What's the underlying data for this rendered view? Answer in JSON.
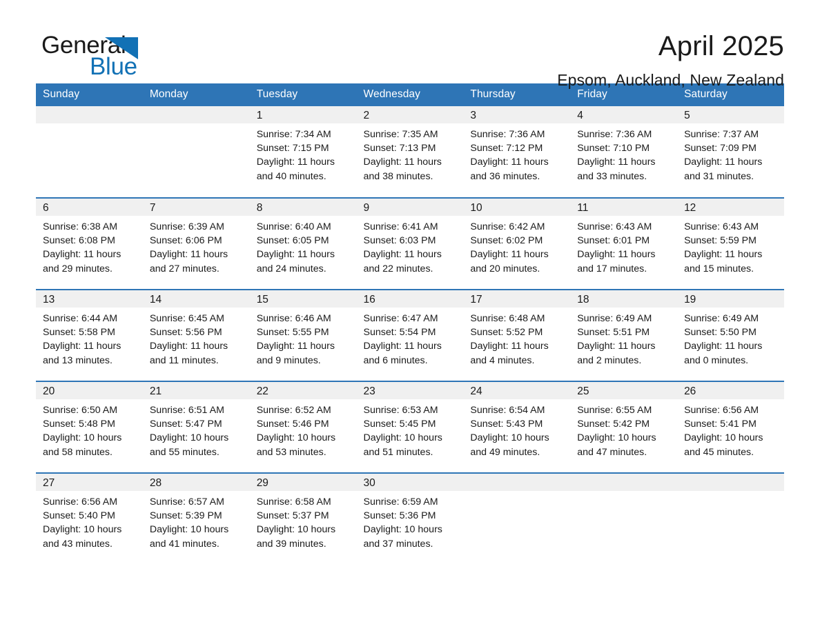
{
  "brand": {
    "name_part1": "General",
    "name_part2": "Blue",
    "accent_color": "#1271b5"
  },
  "header": {
    "title": "April 2025",
    "location": "Epsom, Auckland, New Zealand"
  },
  "theme": {
    "header_blue": "#2e75b6",
    "daynum_background": "#f0f0f0",
    "page_background": "#ffffff"
  },
  "weekday_headers": [
    "Sunday",
    "Monday",
    "Tuesday",
    "Wednesday",
    "Thursday",
    "Friday",
    "Saturday"
  ],
  "weeks": [
    [
      {
        "day": "",
        "sunrise": "",
        "sunset": "",
        "daylight_line1": "",
        "daylight_line2": ""
      },
      {
        "day": "",
        "sunrise": "",
        "sunset": "",
        "daylight_line1": "",
        "daylight_line2": ""
      },
      {
        "day": "1",
        "sunrise": "Sunrise: 7:34 AM",
        "sunset": "Sunset: 7:15 PM",
        "daylight_line1": "Daylight: 11 hours",
        "daylight_line2": "and 40 minutes."
      },
      {
        "day": "2",
        "sunrise": "Sunrise: 7:35 AM",
        "sunset": "Sunset: 7:13 PM",
        "daylight_line1": "Daylight: 11 hours",
        "daylight_line2": "and 38 minutes."
      },
      {
        "day": "3",
        "sunrise": "Sunrise: 7:36 AM",
        "sunset": "Sunset: 7:12 PM",
        "daylight_line1": "Daylight: 11 hours",
        "daylight_line2": "and 36 minutes."
      },
      {
        "day": "4",
        "sunrise": "Sunrise: 7:36 AM",
        "sunset": "Sunset: 7:10 PM",
        "daylight_line1": "Daylight: 11 hours",
        "daylight_line2": "and 33 minutes."
      },
      {
        "day": "5",
        "sunrise": "Sunrise: 7:37 AM",
        "sunset": "Sunset: 7:09 PM",
        "daylight_line1": "Daylight: 11 hours",
        "daylight_line2": "and 31 minutes."
      }
    ],
    [
      {
        "day": "6",
        "sunrise": "Sunrise: 6:38 AM",
        "sunset": "Sunset: 6:08 PM",
        "daylight_line1": "Daylight: 11 hours",
        "daylight_line2": "and 29 minutes."
      },
      {
        "day": "7",
        "sunrise": "Sunrise: 6:39 AM",
        "sunset": "Sunset: 6:06 PM",
        "daylight_line1": "Daylight: 11 hours",
        "daylight_line2": "and 27 minutes."
      },
      {
        "day": "8",
        "sunrise": "Sunrise: 6:40 AM",
        "sunset": "Sunset: 6:05 PM",
        "daylight_line1": "Daylight: 11 hours",
        "daylight_line2": "and 24 minutes."
      },
      {
        "day": "9",
        "sunrise": "Sunrise: 6:41 AM",
        "sunset": "Sunset: 6:03 PM",
        "daylight_line1": "Daylight: 11 hours",
        "daylight_line2": "and 22 minutes."
      },
      {
        "day": "10",
        "sunrise": "Sunrise: 6:42 AM",
        "sunset": "Sunset: 6:02 PM",
        "daylight_line1": "Daylight: 11 hours",
        "daylight_line2": "and 20 minutes."
      },
      {
        "day": "11",
        "sunrise": "Sunrise: 6:43 AM",
        "sunset": "Sunset: 6:01 PM",
        "daylight_line1": "Daylight: 11 hours",
        "daylight_line2": "and 17 minutes."
      },
      {
        "day": "12",
        "sunrise": "Sunrise: 6:43 AM",
        "sunset": "Sunset: 5:59 PM",
        "daylight_line1": "Daylight: 11 hours",
        "daylight_line2": "and 15 minutes."
      }
    ],
    [
      {
        "day": "13",
        "sunrise": "Sunrise: 6:44 AM",
        "sunset": "Sunset: 5:58 PM",
        "daylight_line1": "Daylight: 11 hours",
        "daylight_line2": "and 13 minutes."
      },
      {
        "day": "14",
        "sunrise": "Sunrise: 6:45 AM",
        "sunset": "Sunset: 5:56 PM",
        "daylight_line1": "Daylight: 11 hours",
        "daylight_line2": "and 11 minutes."
      },
      {
        "day": "15",
        "sunrise": "Sunrise: 6:46 AM",
        "sunset": "Sunset: 5:55 PM",
        "daylight_line1": "Daylight: 11 hours",
        "daylight_line2": "and 9 minutes."
      },
      {
        "day": "16",
        "sunrise": "Sunrise: 6:47 AM",
        "sunset": "Sunset: 5:54 PM",
        "daylight_line1": "Daylight: 11 hours",
        "daylight_line2": "and 6 minutes."
      },
      {
        "day": "17",
        "sunrise": "Sunrise: 6:48 AM",
        "sunset": "Sunset: 5:52 PM",
        "daylight_line1": "Daylight: 11 hours",
        "daylight_line2": "and 4 minutes."
      },
      {
        "day": "18",
        "sunrise": "Sunrise: 6:49 AM",
        "sunset": "Sunset: 5:51 PM",
        "daylight_line1": "Daylight: 11 hours",
        "daylight_line2": "and 2 minutes."
      },
      {
        "day": "19",
        "sunrise": "Sunrise: 6:49 AM",
        "sunset": "Sunset: 5:50 PM",
        "daylight_line1": "Daylight: 11 hours",
        "daylight_line2": "and 0 minutes."
      }
    ],
    [
      {
        "day": "20",
        "sunrise": "Sunrise: 6:50 AM",
        "sunset": "Sunset: 5:48 PM",
        "daylight_line1": "Daylight: 10 hours",
        "daylight_line2": "and 58 minutes."
      },
      {
        "day": "21",
        "sunrise": "Sunrise: 6:51 AM",
        "sunset": "Sunset: 5:47 PM",
        "daylight_line1": "Daylight: 10 hours",
        "daylight_line2": "and 55 minutes."
      },
      {
        "day": "22",
        "sunrise": "Sunrise: 6:52 AM",
        "sunset": "Sunset: 5:46 PM",
        "daylight_line1": "Daylight: 10 hours",
        "daylight_line2": "and 53 minutes."
      },
      {
        "day": "23",
        "sunrise": "Sunrise: 6:53 AM",
        "sunset": "Sunset: 5:45 PM",
        "daylight_line1": "Daylight: 10 hours",
        "daylight_line2": "and 51 minutes."
      },
      {
        "day": "24",
        "sunrise": "Sunrise: 6:54 AM",
        "sunset": "Sunset: 5:43 PM",
        "daylight_line1": "Daylight: 10 hours",
        "daylight_line2": "and 49 minutes."
      },
      {
        "day": "25",
        "sunrise": "Sunrise: 6:55 AM",
        "sunset": "Sunset: 5:42 PM",
        "daylight_line1": "Daylight: 10 hours",
        "daylight_line2": "and 47 minutes."
      },
      {
        "day": "26",
        "sunrise": "Sunrise: 6:56 AM",
        "sunset": "Sunset: 5:41 PM",
        "daylight_line1": "Daylight: 10 hours",
        "daylight_line2": "and 45 minutes."
      }
    ],
    [
      {
        "day": "27",
        "sunrise": "Sunrise: 6:56 AM",
        "sunset": "Sunset: 5:40 PM",
        "daylight_line1": "Daylight: 10 hours",
        "daylight_line2": "and 43 minutes."
      },
      {
        "day": "28",
        "sunrise": "Sunrise: 6:57 AM",
        "sunset": "Sunset: 5:39 PM",
        "daylight_line1": "Daylight: 10 hours",
        "daylight_line2": "and 41 minutes."
      },
      {
        "day": "29",
        "sunrise": "Sunrise: 6:58 AM",
        "sunset": "Sunset: 5:37 PM",
        "daylight_line1": "Daylight: 10 hours",
        "daylight_line2": "and 39 minutes."
      },
      {
        "day": "30",
        "sunrise": "Sunrise: 6:59 AM",
        "sunset": "Sunset: 5:36 PM",
        "daylight_line1": "Daylight: 10 hours",
        "daylight_line2": "and 37 minutes."
      },
      {
        "day": "",
        "sunrise": "",
        "sunset": "",
        "daylight_line1": "",
        "daylight_line2": ""
      },
      {
        "day": "",
        "sunrise": "",
        "sunset": "",
        "daylight_line1": "",
        "daylight_line2": ""
      },
      {
        "day": "",
        "sunrise": "",
        "sunset": "",
        "daylight_line1": "",
        "daylight_line2": ""
      }
    ]
  ]
}
